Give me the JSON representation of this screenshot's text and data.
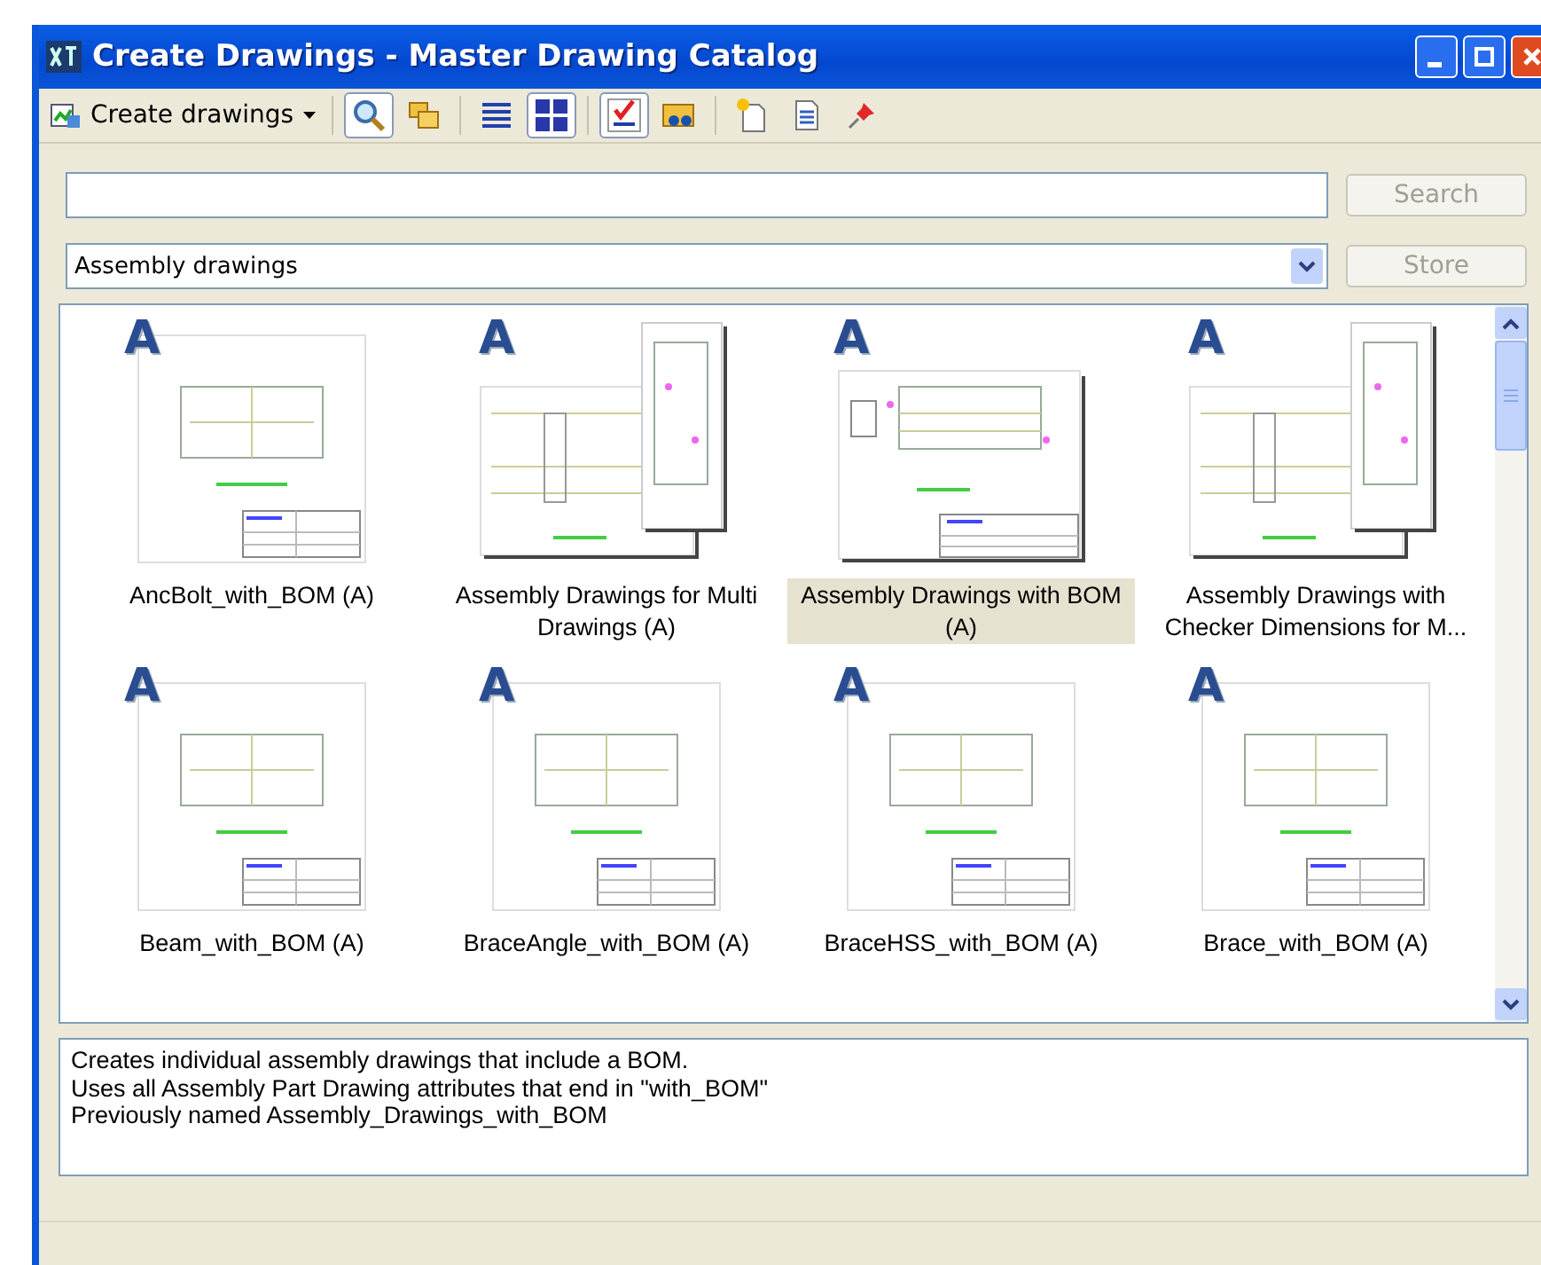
{
  "window": {
    "title": "Create Drawings - Master Drawing Catalog"
  },
  "toolbar": {
    "create_label": "Create drawings",
    "tools": [
      {
        "kind": "search",
        "selected": true
      },
      {
        "kind": "folders",
        "selected": false
      },
      {
        "kind": "list",
        "selected": false
      },
      {
        "kind": "grid",
        "selected": true
      },
      {
        "kind": "check",
        "selected": true
      },
      {
        "kind": "find-folder",
        "selected": false
      },
      {
        "kind": "new",
        "selected": false
      },
      {
        "kind": "document",
        "selected": false
      },
      {
        "kind": "pin",
        "selected": false
      }
    ]
  },
  "search": {
    "button": "Search"
  },
  "filter": {
    "value": "Assembly drawings",
    "button": "Store"
  },
  "items": [
    {
      "badge": "A",
      "label": "AncBolt_with_BOM (A)",
      "kind": "single",
      "selected": false
    },
    {
      "badge": "A",
      "label": "Assembly Drawings for Multi Drawings (A)",
      "kind": "multi",
      "selected": false
    },
    {
      "badge": "A",
      "label": "Assembly Drawings with BOM (A)",
      "kind": "wide",
      "selected": true
    },
    {
      "badge": "A",
      "label": "Assembly Drawings with Checker Dimensions for M...",
      "kind": "multi",
      "selected": false
    },
    {
      "badge": "A",
      "label": "Beam_with_BOM (A)",
      "kind": "single",
      "selected": false
    },
    {
      "badge": "A",
      "label": "BraceAngle_with_BOM (A)",
      "kind": "single",
      "selected": false
    },
    {
      "badge": "A",
      "label": "BraceHSS_with_BOM (A)",
      "kind": "single",
      "selected": false
    },
    {
      "badge": "A",
      "label": "Brace_with_BOM (A)",
      "kind": "single",
      "selected": false
    }
  ],
  "description": [
    "Creates individual assembly drawings that include a BOM.",
    "Uses all Assembly Part Drawing attributes that end in \"with_BOM\"",
    "Previously named Assembly_Drawings_with_BOM"
  ]
}
